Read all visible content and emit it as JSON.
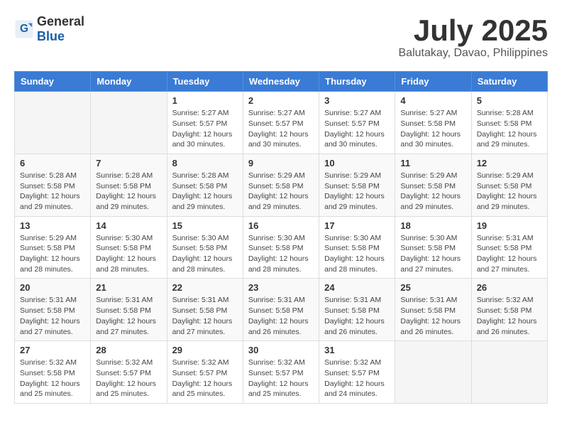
{
  "header": {
    "logo_general": "General",
    "logo_blue": "Blue",
    "month_title": "July 2025",
    "location": "Balutakay, Davao, Philippines"
  },
  "calendar": {
    "headers": [
      "Sunday",
      "Monday",
      "Tuesday",
      "Wednesday",
      "Thursday",
      "Friday",
      "Saturday"
    ],
    "weeks": [
      [
        {
          "day": "",
          "info": ""
        },
        {
          "day": "",
          "info": ""
        },
        {
          "day": "1",
          "info": "Sunrise: 5:27 AM\nSunset: 5:57 PM\nDaylight: 12 hours and 30 minutes."
        },
        {
          "day": "2",
          "info": "Sunrise: 5:27 AM\nSunset: 5:57 PM\nDaylight: 12 hours and 30 minutes."
        },
        {
          "day": "3",
          "info": "Sunrise: 5:27 AM\nSunset: 5:57 PM\nDaylight: 12 hours and 30 minutes."
        },
        {
          "day": "4",
          "info": "Sunrise: 5:27 AM\nSunset: 5:58 PM\nDaylight: 12 hours and 30 minutes."
        },
        {
          "day": "5",
          "info": "Sunrise: 5:28 AM\nSunset: 5:58 PM\nDaylight: 12 hours and 29 minutes."
        }
      ],
      [
        {
          "day": "6",
          "info": "Sunrise: 5:28 AM\nSunset: 5:58 PM\nDaylight: 12 hours and 29 minutes."
        },
        {
          "day": "7",
          "info": "Sunrise: 5:28 AM\nSunset: 5:58 PM\nDaylight: 12 hours and 29 minutes."
        },
        {
          "day": "8",
          "info": "Sunrise: 5:28 AM\nSunset: 5:58 PM\nDaylight: 12 hours and 29 minutes."
        },
        {
          "day": "9",
          "info": "Sunrise: 5:29 AM\nSunset: 5:58 PM\nDaylight: 12 hours and 29 minutes."
        },
        {
          "day": "10",
          "info": "Sunrise: 5:29 AM\nSunset: 5:58 PM\nDaylight: 12 hours and 29 minutes."
        },
        {
          "day": "11",
          "info": "Sunrise: 5:29 AM\nSunset: 5:58 PM\nDaylight: 12 hours and 29 minutes."
        },
        {
          "day": "12",
          "info": "Sunrise: 5:29 AM\nSunset: 5:58 PM\nDaylight: 12 hours and 29 minutes."
        }
      ],
      [
        {
          "day": "13",
          "info": "Sunrise: 5:29 AM\nSunset: 5:58 PM\nDaylight: 12 hours and 28 minutes."
        },
        {
          "day": "14",
          "info": "Sunrise: 5:30 AM\nSunset: 5:58 PM\nDaylight: 12 hours and 28 minutes."
        },
        {
          "day": "15",
          "info": "Sunrise: 5:30 AM\nSunset: 5:58 PM\nDaylight: 12 hours and 28 minutes."
        },
        {
          "day": "16",
          "info": "Sunrise: 5:30 AM\nSunset: 5:58 PM\nDaylight: 12 hours and 28 minutes."
        },
        {
          "day": "17",
          "info": "Sunrise: 5:30 AM\nSunset: 5:58 PM\nDaylight: 12 hours and 28 minutes."
        },
        {
          "day": "18",
          "info": "Sunrise: 5:30 AM\nSunset: 5:58 PM\nDaylight: 12 hours and 27 minutes."
        },
        {
          "day": "19",
          "info": "Sunrise: 5:31 AM\nSunset: 5:58 PM\nDaylight: 12 hours and 27 minutes."
        }
      ],
      [
        {
          "day": "20",
          "info": "Sunrise: 5:31 AM\nSunset: 5:58 PM\nDaylight: 12 hours and 27 minutes."
        },
        {
          "day": "21",
          "info": "Sunrise: 5:31 AM\nSunset: 5:58 PM\nDaylight: 12 hours and 27 minutes."
        },
        {
          "day": "22",
          "info": "Sunrise: 5:31 AM\nSunset: 5:58 PM\nDaylight: 12 hours and 27 minutes."
        },
        {
          "day": "23",
          "info": "Sunrise: 5:31 AM\nSunset: 5:58 PM\nDaylight: 12 hours and 26 minutes."
        },
        {
          "day": "24",
          "info": "Sunrise: 5:31 AM\nSunset: 5:58 PM\nDaylight: 12 hours and 26 minutes."
        },
        {
          "day": "25",
          "info": "Sunrise: 5:31 AM\nSunset: 5:58 PM\nDaylight: 12 hours and 26 minutes."
        },
        {
          "day": "26",
          "info": "Sunrise: 5:32 AM\nSunset: 5:58 PM\nDaylight: 12 hours and 26 minutes."
        }
      ],
      [
        {
          "day": "27",
          "info": "Sunrise: 5:32 AM\nSunset: 5:58 PM\nDaylight: 12 hours and 25 minutes."
        },
        {
          "day": "28",
          "info": "Sunrise: 5:32 AM\nSunset: 5:57 PM\nDaylight: 12 hours and 25 minutes."
        },
        {
          "day": "29",
          "info": "Sunrise: 5:32 AM\nSunset: 5:57 PM\nDaylight: 12 hours and 25 minutes."
        },
        {
          "day": "30",
          "info": "Sunrise: 5:32 AM\nSunset: 5:57 PM\nDaylight: 12 hours and 25 minutes."
        },
        {
          "day": "31",
          "info": "Sunrise: 5:32 AM\nSunset: 5:57 PM\nDaylight: 12 hours and 24 minutes."
        },
        {
          "day": "",
          "info": ""
        },
        {
          "day": "",
          "info": ""
        }
      ]
    ]
  }
}
